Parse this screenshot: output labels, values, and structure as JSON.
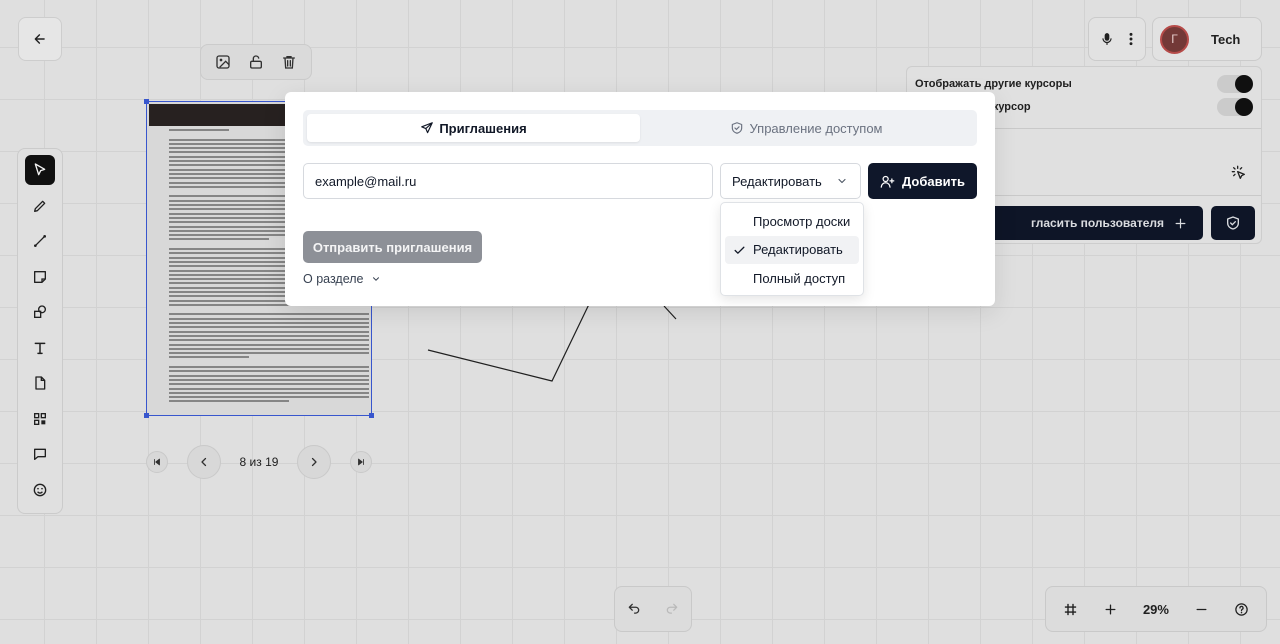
{
  "canvas": {
    "pager": {
      "text": "8 из 19"
    }
  },
  "header": {
    "user": {
      "avatar_initial": "Г",
      "name": "Tech"
    }
  },
  "settings_panel": {
    "show_cursors_label": "Отображать другие курсоры",
    "my_cursor_label": "й курсор",
    "invite_user_label": "гласить пользователя"
  },
  "zoom": {
    "level": "29%"
  },
  "modal": {
    "tabs": [
      {
        "label": "Приглашения",
        "icon": "send-icon",
        "active": true
      },
      {
        "label": "Управление доступом",
        "icon": "shield-check-icon",
        "active": false
      }
    ],
    "email": {
      "value": "example@mail.ru"
    },
    "role_select": {
      "value": "Редактировать"
    },
    "add_button": {
      "label": "Добавить"
    },
    "send_button": {
      "label": "Отправить приглашения"
    },
    "about_link": {
      "label": "О разделе"
    },
    "role_options": [
      {
        "label": "Просмотр доски",
        "selected": false
      },
      {
        "label": "Редактировать",
        "selected": true
      },
      {
        "label": "Полный доступ",
        "selected": false
      }
    ]
  }
}
